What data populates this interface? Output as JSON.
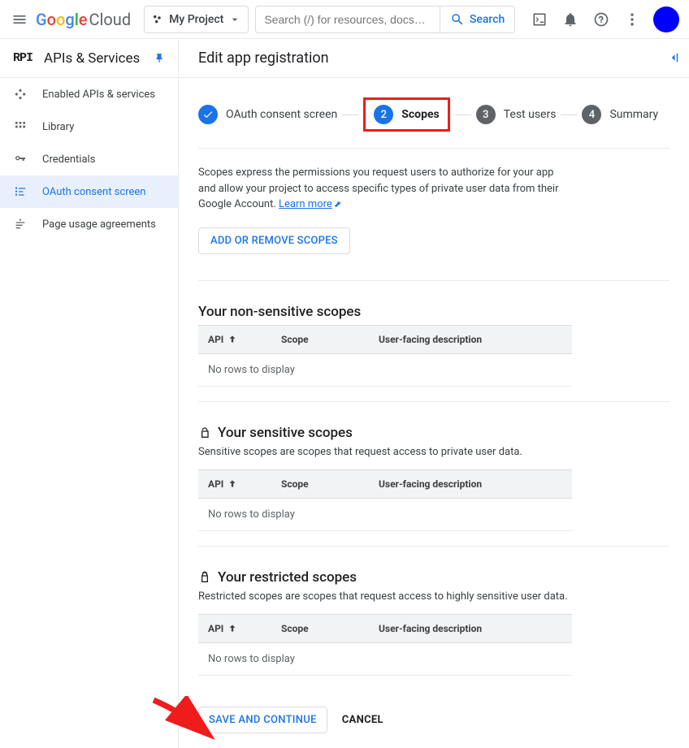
{
  "header": {
    "logo_cloud": "Cloud",
    "project_name": "My Project",
    "search_placeholder": "Search (/) for resources, docs…",
    "search_button": "Search"
  },
  "sidebar": {
    "title": "APIs & Services",
    "items": [
      {
        "label": "Enabled APIs & services"
      },
      {
        "label": "Library"
      },
      {
        "label": "Credentials"
      },
      {
        "label": "OAuth consent screen"
      },
      {
        "label": "Page usage agreements"
      }
    ]
  },
  "page_title": "Edit app registration",
  "stepper": [
    {
      "label": "OAuth consent screen"
    },
    {
      "num": "2",
      "label": "Scopes"
    },
    {
      "num": "3",
      "label": "Test users"
    },
    {
      "num": "4",
      "label": "Summary"
    }
  ],
  "intro": "Scopes express the permissions you request users to authorize for your app and allow your project to access specific types of private user data from their Google Account. ",
  "learn_more": "Learn more",
  "add_scopes_btn": "ADD OR REMOVE SCOPES",
  "columns": {
    "api": "API",
    "scope": "Scope",
    "desc": "User-facing description"
  },
  "empty_row": "No rows to display",
  "sections": {
    "nonsensitive": {
      "title": "Your non-sensitive scopes"
    },
    "sensitive": {
      "title": "Your sensitive scopes",
      "desc": "Sensitive scopes are scopes that request access to private user data."
    },
    "restricted": {
      "title": "Your restricted scopes",
      "desc": "Restricted scopes are scopes that request access to highly sensitive user data."
    }
  },
  "footer": {
    "save": "SAVE AND CONTINUE",
    "cancel": "CANCEL"
  }
}
